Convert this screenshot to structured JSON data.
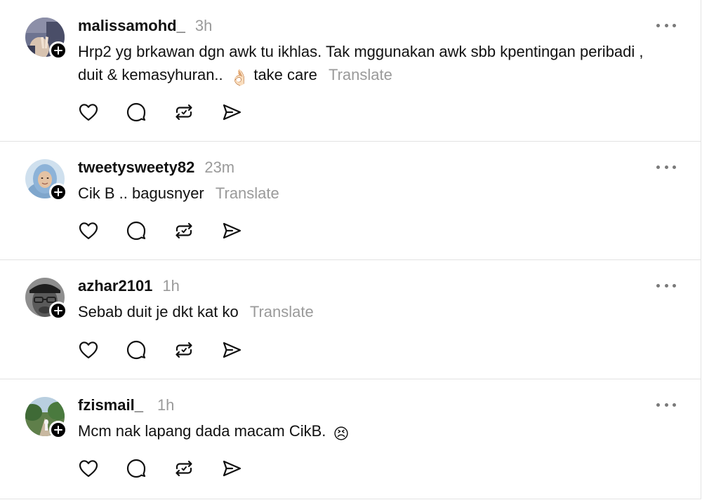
{
  "posts": [
    {
      "username": "malissamohd_",
      "time": "3h",
      "text": "Hrp2 yg brkawan dgn awk tu ikhlas. Tak mggunakan awk sbb kpentingan peribadi , duit & kemasyhuran..",
      "emoji": "👌🏻",
      "text_after": "take care",
      "translate": "Translate"
    },
    {
      "username": "tweetysweety82",
      "time": "23m",
      "text": "Cik B .. bagusnyer",
      "translate": "Translate"
    },
    {
      "username": "azhar2101",
      "time": "1h",
      "text": "Sebab duit je dkt kat ko",
      "translate": "Translate"
    },
    {
      "username": "fzismail_",
      "time": "1h",
      "text": "Mcm nak lapang dada macam CikB.",
      "emoji": "😣"
    }
  ],
  "icons": {
    "like": "heart-icon",
    "reply": "comment-icon",
    "repost": "repost-icon",
    "share": "send-icon",
    "more": "more-icon",
    "follow": "plus-icon"
  }
}
